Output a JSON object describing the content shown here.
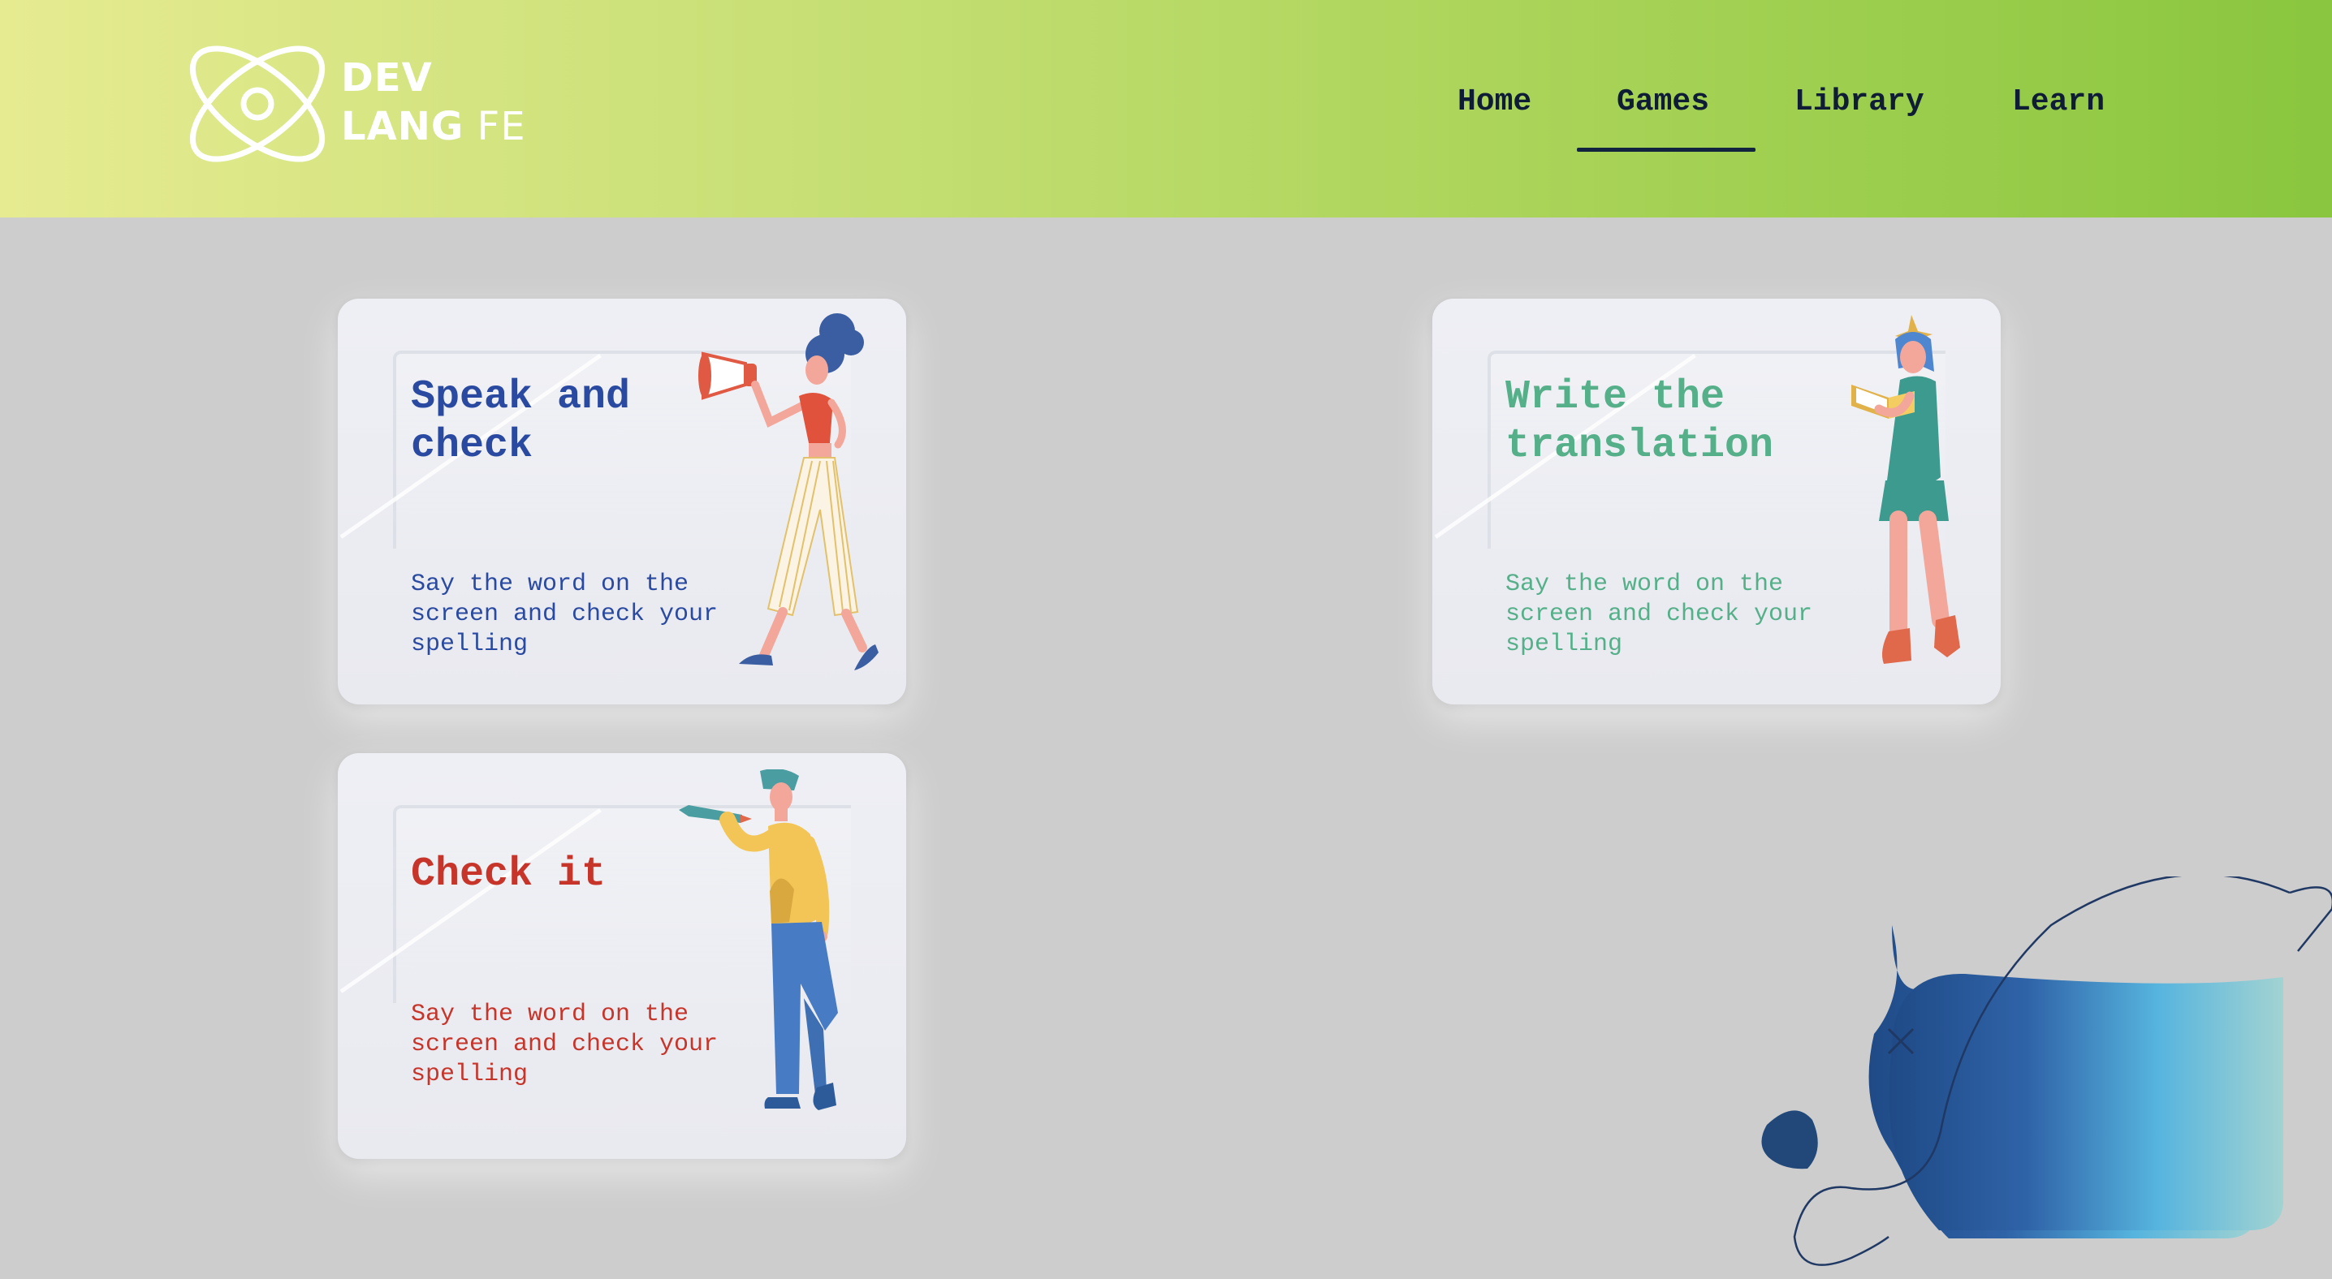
{
  "brand": {
    "line1": "DEV",
    "line2_bold": "LANG",
    "line2_light": "FE",
    "logo_icon": "atom-orbit-icon"
  },
  "nav": {
    "items": [
      {
        "label": "Home",
        "active": false
      },
      {
        "label": "Games",
        "active": true
      },
      {
        "label": "Library",
        "active": false
      },
      {
        "label": "Learn",
        "active": false
      }
    ]
  },
  "cards": [
    {
      "title": "Speak and check",
      "description": "Say the word on the screen and check your spelling",
      "color": "#2a4aa1",
      "illustration": "woman-with-megaphone"
    },
    {
      "title": "Write the translation",
      "description": "Say the word on the screen and check your spelling",
      "color": "#55b08a",
      "illustration": "woman-reading-book"
    },
    {
      "title": "Check it",
      "description": "Say the word on the screen and check your spelling",
      "color": "#c7352a",
      "illustration": "man-with-pencil"
    }
  ],
  "colors": {
    "header_gradient_start": "#e6eb91",
    "header_gradient_end": "#8ac63f",
    "nav_text": "#0e1c35",
    "background": "#cdcdcd"
  }
}
